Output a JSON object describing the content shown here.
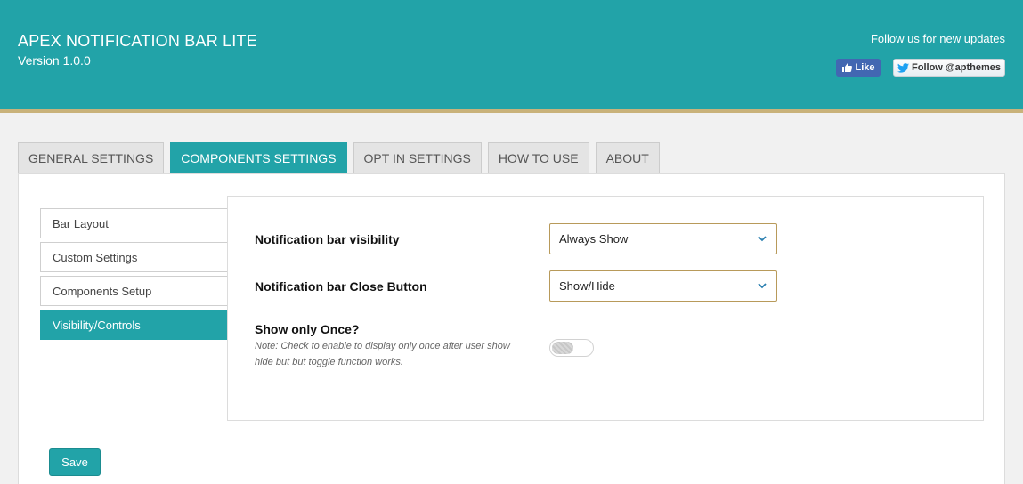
{
  "header": {
    "title": "APEX NOTIFICATION BAR LITE",
    "version": "Version 1.0.0",
    "follow_text": "Follow us for new updates",
    "like_label": "Like",
    "twitter_label": "Follow @apthemes"
  },
  "tabs": [
    {
      "label": "GENERAL SETTINGS"
    },
    {
      "label": "COMPONENTS SETTINGS",
      "active": true
    },
    {
      "label": "OPT IN SETTINGS"
    },
    {
      "label": "HOW TO USE"
    },
    {
      "label": "ABOUT"
    }
  ],
  "sidebar": {
    "items": [
      {
        "label": "Bar Layout"
      },
      {
        "label": "Custom Settings"
      },
      {
        "label": "Components Setup"
      },
      {
        "label": "Visibility/Controls",
        "active": true
      }
    ]
  },
  "form": {
    "visibility_label": "Notification bar visibility",
    "visibility_value": "Always Show",
    "close_label": "Notification bar Close Button",
    "close_value": "Show/Hide",
    "once_label": "Show only Once?",
    "once_note": "Note: Check to enable to display only once after user show hide but but toggle function works.",
    "once_enabled": false
  },
  "save_label": "Save",
  "colors": {
    "accent": "#22a3a8",
    "header_border": "#c9b27a",
    "select_border": "#b89a5a"
  }
}
